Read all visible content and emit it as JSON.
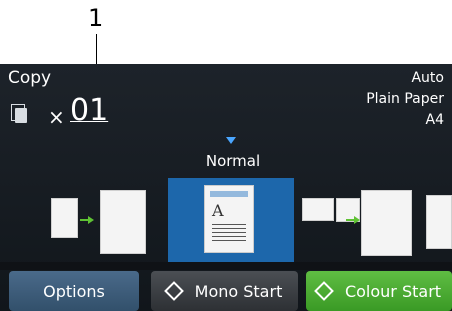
{
  "callout": {
    "number": "1"
  },
  "header": {
    "title": "Copy",
    "copies_prefix": "×",
    "copies_count": "01"
  },
  "settings": {
    "line1": "Auto",
    "line2": "Plain Paper",
    "line3": "A4"
  },
  "quality": {
    "label": "Normal"
  },
  "buttons": {
    "options": "Options",
    "mono_start": "Mono Start",
    "colour_start": "Colour Start"
  },
  "icons": {
    "copies": "document-copies-icon",
    "quality_marker": "triangle-down-icon",
    "mono_start": "diamond-icon",
    "colour_start": "diamond-icon"
  },
  "colors": {
    "selected": "#1d67ab",
    "marker": "#4aa6ff",
    "arrow": "#5fc234",
    "colour_start": "#4caf36"
  }
}
